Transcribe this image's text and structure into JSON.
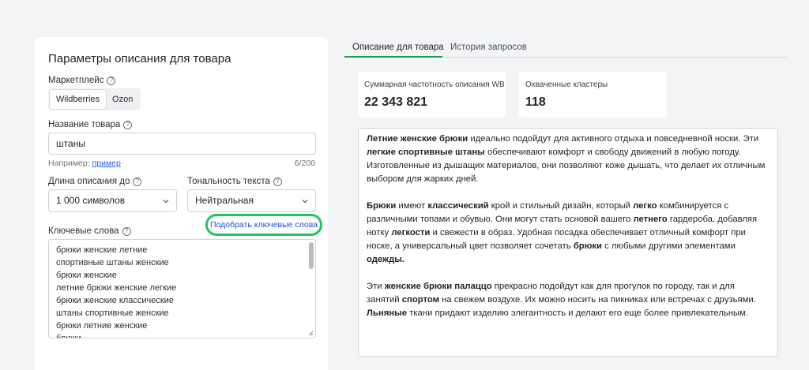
{
  "left": {
    "title": "Параметры описания для товара",
    "marketplace_label": "Маркетплейс",
    "marketplaces": [
      "Wildberries",
      "Ozon"
    ],
    "name_label": "Название товара",
    "name_value": "штаны",
    "hint_prefix": "Например: ",
    "hint_link": "пример",
    "counter": "6/200",
    "length_label": "Длина описания до",
    "length_value": "1 000 символов",
    "tone_label": "Тональность текста",
    "tone_value": "Нейтральная",
    "pick_button": "Подобрать ключевые слова",
    "keywords_label": "Ключевые слова",
    "keywords": [
      "брюки женские летние",
      "спортивные штаны женские",
      "брюки женские",
      "летние брюки женские легкие",
      "брюки женские классические",
      "штаны спортивные женские",
      "брюки летние женские",
      "брюки"
    ]
  },
  "tabs": [
    "Описание для товара",
    "История запросов"
  ],
  "stats": [
    {
      "label": "Суммарная частотность описания WB",
      "value": "22 343 821"
    },
    {
      "label": "Охваченные кластеры",
      "value": "118"
    }
  ],
  "description": [
    [
      {
        "t": "Летние женские брюки",
        "b": true
      },
      {
        "t": " идеально подойдут для активного отдыха и повседневной носки. Эти ",
        "b": false
      },
      {
        "t": "легкие спортивные штаны",
        "b": true
      },
      {
        "t": " обеспечивают комфорт и свободу движений в любую погоду. Изготовленные из дышащих материалов, они позволяют коже дышать, что делает их отличным выбором для жарких дней.",
        "b": false
      }
    ],
    [
      {
        "t": "Брюки",
        "b": true
      },
      {
        "t": " имеют ",
        "b": false
      },
      {
        "t": "классический",
        "b": true
      },
      {
        "t": " крой и стильный дизайн, который ",
        "b": false
      },
      {
        "t": "легко",
        "b": true
      },
      {
        "t": " комбинируется с различными топами и обувью. Они могут стать основой вашего ",
        "b": false
      },
      {
        "t": "летнего",
        "b": true
      },
      {
        "t": " гардероба, добавляя нотку ",
        "b": false
      },
      {
        "t": "легкости",
        "b": true
      },
      {
        "t": " и свежести в образ. Удобная посадка обеспечивает отличный комфорт при носке, а универсальный цвет позволяет сочетать ",
        "b": false
      },
      {
        "t": "брюки",
        "b": true
      },
      {
        "t": " с любыми другими элементами ",
        "b": false
      },
      {
        "t": "одежды.",
        "b": true
      }
    ],
    [
      {
        "t": "Эти ",
        "b": false
      },
      {
        "t": "женские брюки палаццо",
        "b": true
      },
      {
        "t": " прекрасно подойдут как для прогулок по городу, так и для занятий ",
        "b": false
      },
      {
        "t": "спортом",
        "b": true
      },
      {
        "t": " на свежем воздухе. Их можно носить на пикниках или встречах с друзьями. ",
        "b": false
      },
      {
        "t": "Льняные",
        "b": true
      },
      {
        "t": " ткани придают изделию элегантность и делают его еще более привлекательным.",
        "b": false
      }
    ]
  ],
  "icons": {
    "help": "help-circle-icon",
    "chevron": "chevron-down-icon"
  },
  "colors": {
    "accent": "#16a34a",
    "highlight": "#22c55e",
    "link": "#2563eb"
  }
}
